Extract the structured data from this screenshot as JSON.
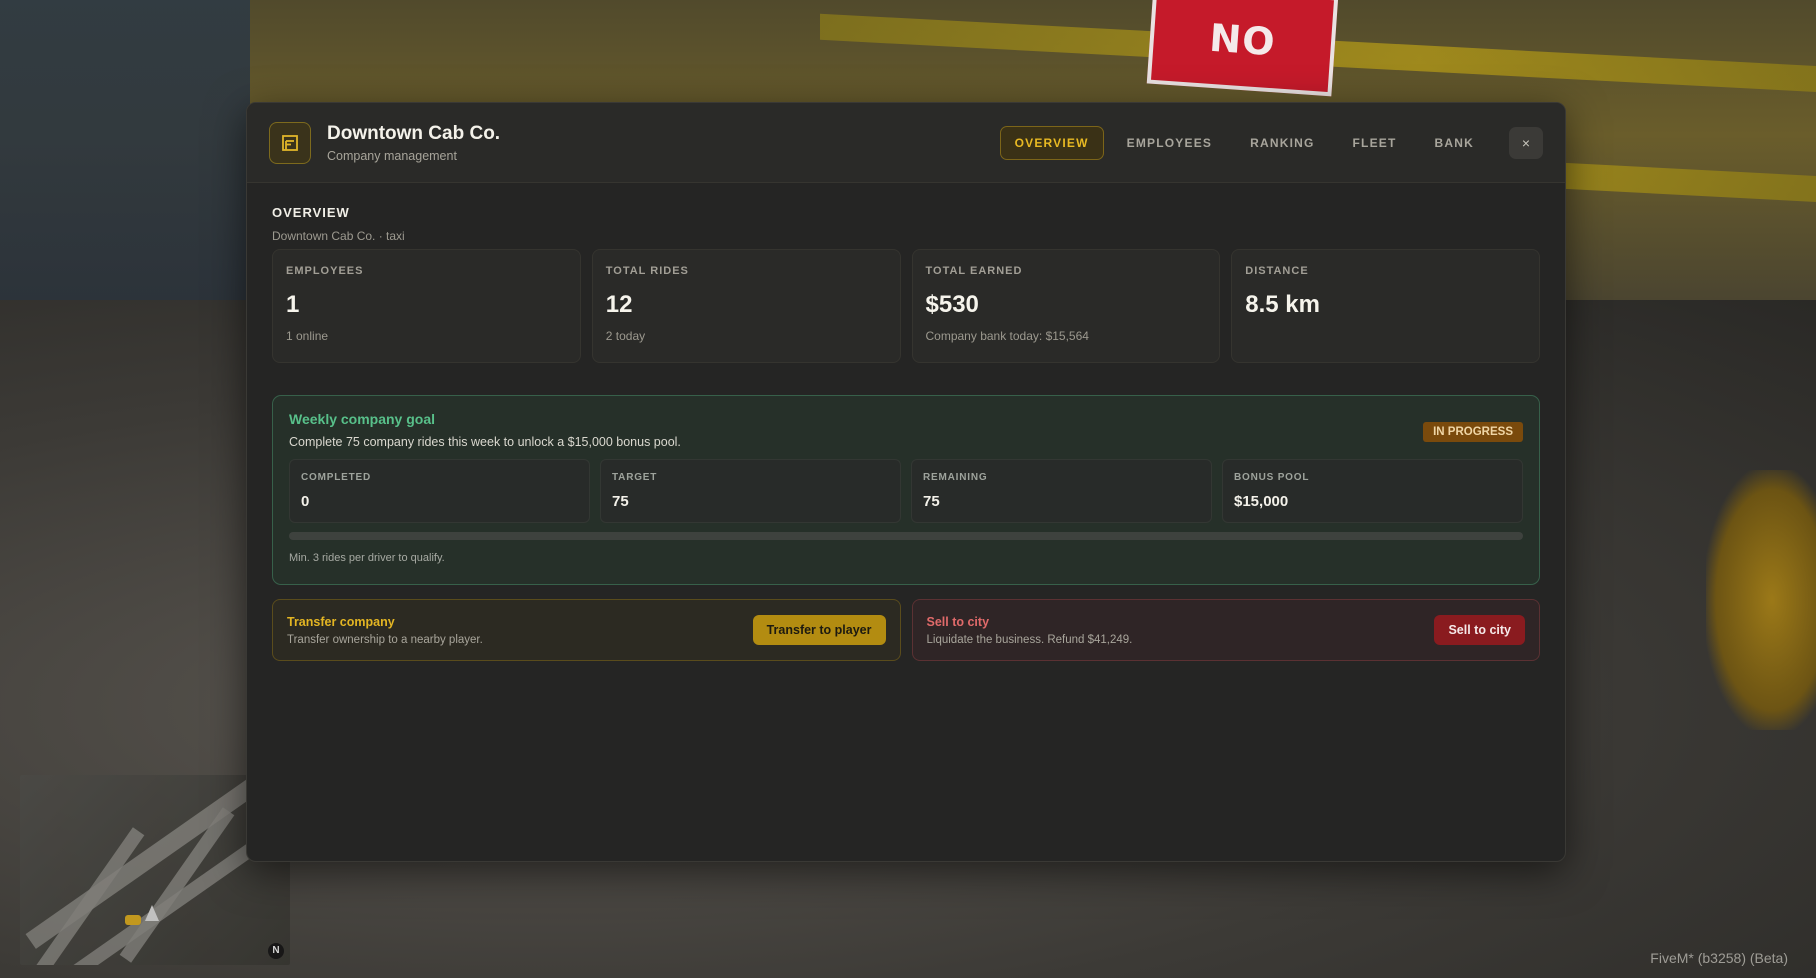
{
  "background": {
    "sign_text": "NO PARKING",
    "minimap_north": "N",
    "watermark": "FiveM* (b3258) (Beta)"
  },
  "header": {
    "logo_icon": "document-icon",
    "title": "Downtown Cab Co.",
    "subtitle": "Company management",
    "tabs": [
      {
        "label": "OVERVIEW",
        "active": true
      },
      {
        "label": "EMPLOYEES",
        "active": false
      },
      {
        "label": "RANKING",
        "active": false
      },
      {
        "label": "FLEET",
        "active": false
      },
      {
        "label": "BANK",
        "active": false
      }
    ],
    "close_label": "×"
  },
  "overview": {
    "title": "OVERVIEW",
    "subtitle": "Downtown Cab Co. · taxi",
    "stats": [
      {
        "label": "EMPLOYEES",
        "value": "1",
        "sub": "1 online"
      },
      {
        "label": "TOTAL RIDES",
        "value": "12",
        "sub": "2 today"
      },
      {
        "label": "TOTAL EARNED",
        "value": "$530",
        "sub": "Company bank today: $15,564"
      },
      {
        "label": "DISTANCE",
        "value": "8.5 km",
        "sub": ""
      }
    ]
  },
  "goal": {
    "title": "Weekly company goal",
    "description": "Complete 75 company rides this week to unlock a $15,000 bonus pool.",
    "badge": "IN PROGRESS",
    "stats": [
      {
        "label": "COMPLETED",
        "value": "0"
      },
      {
        "label": "TARGET",
        "value": "75"
      },
      {
        "label": "REMAINING",
        "value": "75"
      },
      {
        "label": "BONUS POOL",
        "value": "$15,000"
      }
    ],
    "progress": 0,
    "note": "Min. 3 rides per driver to qualify."
  },
  "actions": {
    "transfer": {
      "title": "Transfer company",
      "description": "Transfer ownership to a nearby player.",
      "button": "Transfer to player"
    },
    "sell": {
      "title": "Sell to city",
      "description": "Liquidate the business. Refund $41,249.",
      "button": "Sell to city"
    }
  },
  "colors": {
    "accent": "#e8b923",
    "goal_green": "#58c08a",
    "badge": "#7a4a0c",
    "danger": "#8a1b1f"
  }
}
